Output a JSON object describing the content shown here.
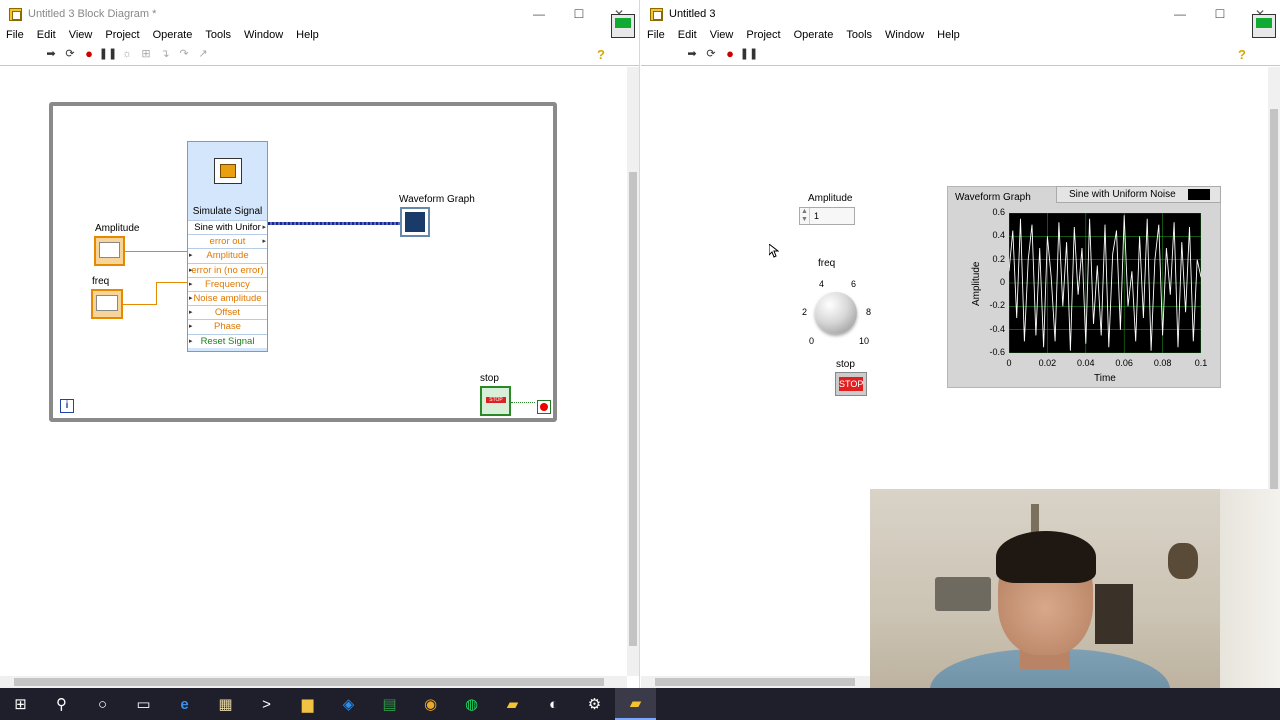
{
  "colors": {
    "wire_orange": "#e58a00",
    "wire_data": "#1a2a8a",
    "express_blue": "#d4e6fb",
    "stop_red": "#e02020",
    "plot_bg": "#000000",
    "plot_line": "#ffffff",
    "grid_green": "#1f8a1f"
  },
  "block_diagram": {
    "title": "Untitled 3 Block Diagram *",
    "menu": [
      "File",
      "Edit",
      "View",
      "Project",
      "Operate",
      "Tools",
      "Window",
      "Help"
    ],
    "toolbar_icons": [
      "run-arrow-icon",
      "run-continuous-icon",
      "abort-icon",
      "pause-icon",
      "highlight-bulb-icon",
      "retain-wire-icon",
      "step-into-icon",
      "step-over-icon",
      "step-out-icon"
    ],
    "amplitude_label": "Amplitude",
    "freq_label": "freq",
    "express_vi_title": "Simulate Signal",
    "express_pins": [
      "Sine with Unifor",
      "error out",
      "Amplitude",
      "error in (no error)",
      "Frequency",
      "Noise amplitude",
      "Offset",
      "Phase",
      "Reset Signal"
    ],
    "graph_label": "Waveform Graph",
    "stop_label": "stop",
    "iteration_terminal": "i"
  },
  "front_panel": {
    "title": "Untitled 3",
    "menu": [
      "File",
      "Edit",
      "View",
      "Project",
      "Operate",
      "Tools",
      "Window",
      "Help"
    ],
    "amplitude_label": "Amplitude",
    "amplitude_value": "1",
    "freq_label": "freq",
    "knob_ticks": [
      "0",
      "2",
      "4",
      "6",
      "8",
      "10"
    ],
    "knob_value": 0,
    "stop_label": "stop",
    "stop_button_text": "STOP",
    "graph_label": "Waveform Graph",
    "legend_name": "Sine with Uniform Noise"
  },
  "chart_data": {
    "type": "line",
    "title": "Waveform Graph",
    "xlabel": "Time",
    "ylabel": "Amplitude",
    "xlim": [
      0,
      0.1
    ],
    "ylim": [
      -0.6,
      0.6
    ],
    "x_ticks": [
      "0",
      "0.02",
      "0.04",
      "0.06",
      "0.08",
      "0.1"
    ],
    "y_ticks": [
      "0.6",
      "0.4",
      "0.2",
      "0",
      "-0.2",
      "-0.4",
      "-0.6"
    ],
    "grid": true,
    "series": [
      {
        "name": "Sine with Uniform Noise",
        "x": [
          0,
          0.002,
          0.004,
          0.006,
          0.008,
          0.01,
          0.012,
          0.014,
          0.016,
          0.018,
          0.02,
          0.022,
          0.024,
          0.026,
          0.028,
          0.03,
          0.032,
          0.034,
          0.036,
          0.038,
          0.04,
          0.042,
          0.044,
          0.046,
          0.048,
          0.05,
          0.052,
          0.054,
          0.056,
          0.058,
          0.06,
          0.062,
          0.064,
          0.066,
          0.068,
          0.07,
          0.072,
          0.074,
          0.076,
          0.078,
          0.08,
          0.082,
          0.084,
          0.086,
          0.088,
          0.09,
          0.092,
          0.094,
          0.096,
          0.098,
          0.1
        ],
        "y": [
          0.1,
          0.45,
          -0.3,
          0.55,
          -0.5,
          0.2,
          0.5,
          -0.45,
          0.3,
          -0.55,
          0.4,
          0.05,
          -0.5,
          0.52,
          -0.2,
          0.35,
          -0.58,
          0.48,
          -0.1,
          0.3,
          -0.52,
          0.55,
          -0.35,
          0.15,
          -0.45,
          0.5,
          -0.55,
          0.25,
          0.45,
          -0.4,
          0.58,
          -0.2,
          0.1,
          -0.5,
          0.4,
          -0.3,
          0.55,
          -0.58,
          0.2,
          0.5,
          -0.45,
          0.3,
          -0.1,
          0.52,
          -0.55,
          0.35,
          -0.25,
          0.48,
          -0.5,
          0.2,
          0.05
        ]
      }
    ]
  },
  "taskbar": {
    "items": [
      "windows-start-icon",
      "search-icon",
      "cortana-icon",
      "task-view-icon",
      "edge-icon",
      "store-icon",
      "cmd-icon",
      "file-explorer-icon",
      "vscode-icon",
      "excel-icon",
      "chrome-icon",
      "spotify-icon",
      "labview-icon",
      "obs-icon",
      "settings-icon",
      "labview-active-icon"
    ],
    "glyphs": [
      "⊞",
      "⚲",
      "○",
      "▭",
      "e",
      "▦",
      ">",
      "▆",
      "◈",
      "▤",
      "◉",
      "◍",
      "▰",
      "◐",
      "⚙",
      "▰"
    ]
  }
}
